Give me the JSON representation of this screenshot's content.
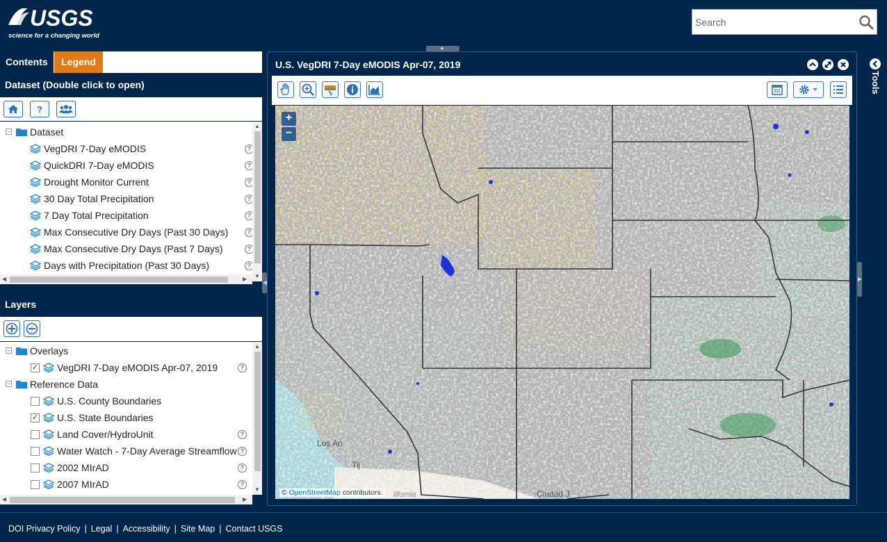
{
  "header": {
    "logo_text": "USGS",
    "tagline": "science for a changing world",
    "search_placeholder": "Search"
  },
  "tabs": [
    {
      "label": "Contents",
      "active": false
    },
    {
      "label": "Legend",
      "active": true
    }
  ],
  "dataset": {
    "title": "Dataset (Double click to open)",
    "toolbar": [
      "home-icon",
      "help-icon",
      "users-icon"
    ],
    "help_glyph": "?",
    "folder_label": "Dataset",
    "items": [
      "VegDRI 7-Day eMODIS",
      "QuickDRI 7-Day eMODIS",
      "Drought Monitor Current",
      "30 Day Total Precipitation",
      "7 Day Total Precipitation",
      "Max Consecutive Dry Days (Past 30 Days)",
      "Max Consecutive Dry Days (Past 7 Days)",
      "Days with Precipitation (Past 30 Days)"
    ]
  },
  "layers": {
    "title": "Layers",
    "toolbar": [
      "expand-all-icon",
      "collapse-all-icon"
    ],
    "overlays_label": "Overlays",
    "overlay_items": [
      {
        "label": "VegDRI 7-Day eMODIS Apr-07, 2019",
        "checked": true,
        "help": true
      }
    ],
    "reference_label": "Reference Data",
    "reference_items": [
      {
        "label": "U.S. County Boundaries",
        "checked": false,
        "help": false
      },
      {
        "label": "U.S. State Boundaries",
        "checked": true,
        "help": false
      },
      {
        "label": "Land Cover/HydroUnit",
        "checked": false,
        "help": true
      },
      {
        "label": "Water Watch - 7-Day Average Streamflow",
        "checked": false,
        "help": true
      },
      {
        "label": "2002 MIrAD",
        "checked": false,
        "help": true
      },
      {
        "label": "2007 MIrAD",
        "checked": false,
        "help": true
      }
    ]
  },
  "map": {
    "title": "U.S. VegDRI 7-Day eMODIS Apr-07, 2019",
    "tools_left": [
      "pan-hand-icon",
      "zoom-in-icon",
      "legend-toggle-icon",
      "info-icon",
      "chart-icon"
    ],
    "tools_right": [
      "calendar-icon",
      "settings-icon",
      "list-icon"
    ],
    "zoom_in": "+",
    "zoom_out": "−",
    "attribution_prefix": "©",
    "attribution_link": "OpenStreetMap",
    "attribution_suffix": "contributors.",
    "place_labels": [
      "Los An",
      "Tij",
      "Ciudad J",
      "lifornia"
    ]
  },
  "tools_rail": {
    "label": "Tools"
  },
  "footer": {
    "links": [
      "DOI Privacy Policy",
      "Legal",
      "Accessibility",
      "Site Map",
      "Contact USGS"
    ],
    "separator": "|"
  },
  "colors": {
    "header_bg": "#00264c",
    "legend_tab": "#e07b1a",
    "button_border": "#2f6fb0",
    "map_gray": "#b4b4b4",
    "drought_orange": "#f0a020",
    "moist_green": "#7fd8a6"
  }
}
